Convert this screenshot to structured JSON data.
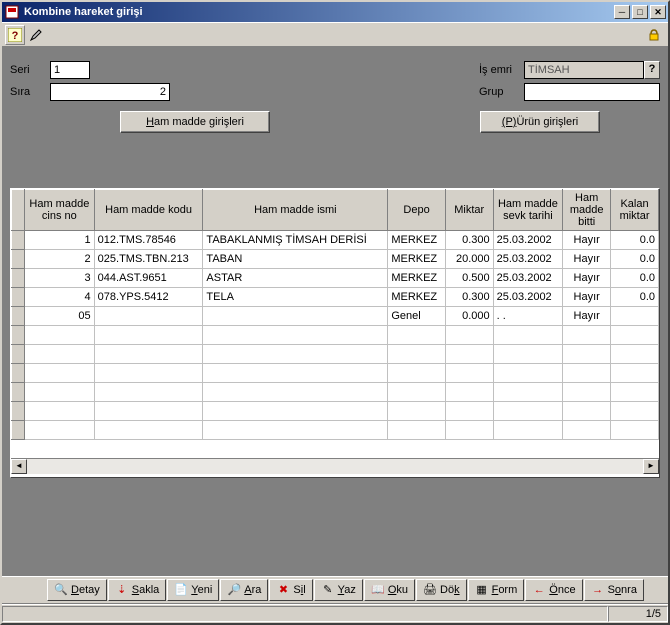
{
  "window": {
    "title": "Kombine hareket girişi"
  },
  "form": {
    "seri_label": "Seri",
    "seri_value": "1",
    "sira_label": "Sıra",
    "sira_value": "2",
    "isemri_label": "İş emri",
    "isemri_value": "TİMSAH",
    "grup_label": "Grup",
    "grup_value": "",
    "ham_btn_pre": "H",
    "ham_btn": "am madde girişleri",
    "urun_btn_pre": "(P)",
    "urun_btn": "Ürün girişleri"
  },
  "columns": {
    "c0": "Ham madde cins no",
    "c1": "Ham madde kodu",
    "c2": "Ham madde ismi",
    "c3": "Depo",
    "c4": "Miktar",
    "c5": "Ham madde sevk tarihi",
    "c6": "Ham madde bitti",
    "c7": "Kalan miktar"
  },
  "rows": [
    {
      "no": "1",
      "kod": "012.TMS.78546",
      "isim": "TABAKLANMIŞ TİMSAH DERİSİ",
      "depo": "MERKEZ",
      "miktar": "0.300",
      "tarih": "25.03.2002",
      "bitti": "Hayır",
      "kalan": "0.0"
    },
    {
      "no": "2",
      "kod": "025.TMS.TBN.213",
      "isim": "TABAN",
      "depo": "MERKEZ",
      "miktar": "20.000",
      "tarih": "25.03.2002",
      "bitti": "Hayır",
      "kalan": "0.0"
    },
    {
      "no": "3",
      "kod": "044.AST.9651",
      "isim": "ASTAR",
      "depo": "MERKEZ",
      "miktar": "0.500",
      "tarih": "25.03.2002",
      "bitti": "Hayır",
      "kalan": "0.0"
    },
    {
      "no": "4",
      "kod": "078.YPS.5412",
      "isim": "TELA",
      "depo": "MERKEZ",
      "miktar": "0.300",
      "tarih": "25.03.2002",
      "bitti": "Hayır",
      "kalan": "0.0"
    },
    {
      "no": "05",
      "kod": "",
      "isim": "",
      "depo": "Genel",
      "miktar": "0.000",
      "tarih": ".  .",
      "bitti": "Hayır",
      "kalan": ""
    }
  ],
  "buttons": {
    "detay": "Detay",
    "sakla": "Sakla",
    "yeni": "Yeni",
    "ara": "Ara",
    "sil": "Sil",
    "yaz": "Yaz",
    "oku": "Oku",
    "dok": "Dök",
    "form": "Form",
    "once": "Önce",
    "sonra": "Sonra"
  },
  "underlines": {
    "detay": "D",
    "sakla": "S",
    "yeni": "Y",
    "ara": "A",
    "sil": "i",
    "yaz": "Y",
    "oku": "O",
    "dok": "k",
    "form": "F",
    "once": "Ö",
    "sonra": "o"
  },
  "status": {
    "pos": "1/5"
  }
}
